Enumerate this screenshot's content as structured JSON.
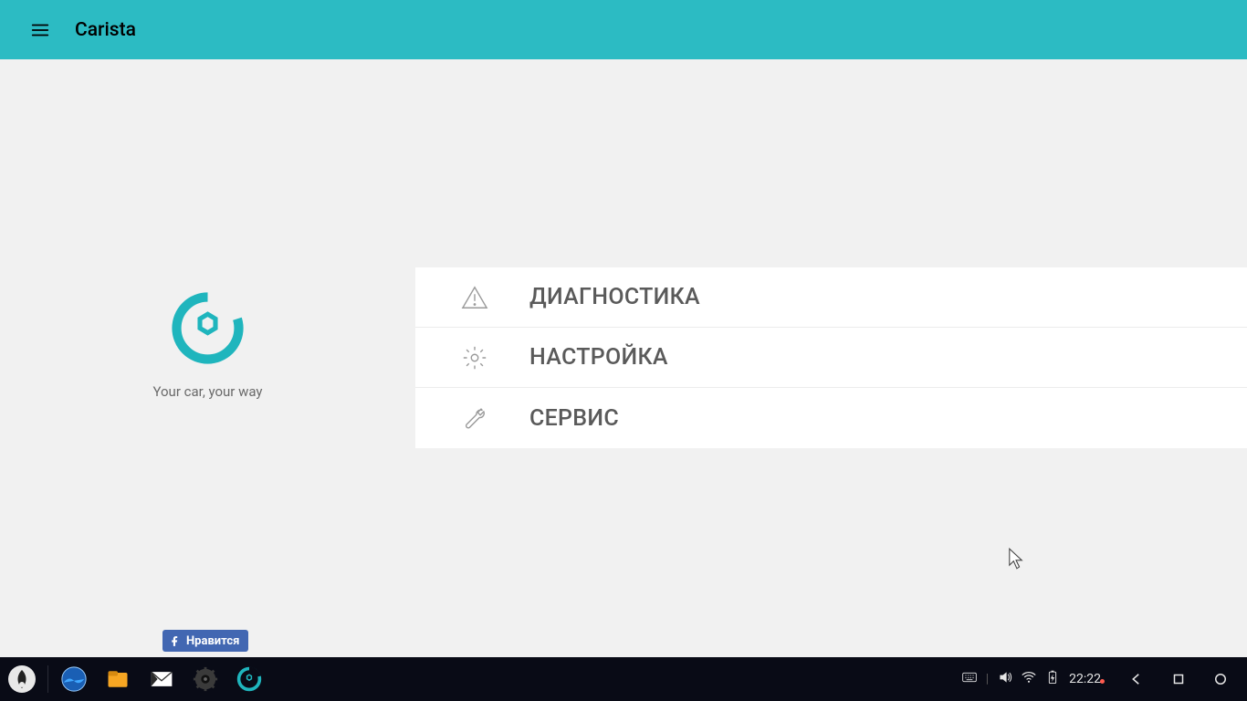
{
  "appbar": {
    "title": "Carista"
  },
  "brand": {
    "tagline": "Your car, your way",
    "accent_color": "#1fb5bd"
  },
  "social": {
    "fb_like_label": "Нравится"
  },
  "menu": {
    "items": [
      {
        "label": "ДИАГНОСТИКА",
        "icon": "warning-triangle-icon"
      },
      {
        "label": "НАСТРОЙКА",
        "icon": "gear-icon"
      },
      {
        "label": "СЕРВИС",
        "icon": "wrench-icon"
      }
    ]
  },
  "taskbar": {
    "clock": "22:22",
    "icons": [
      {
        "name": "phoenix-os-icon"
      },
      {
        "name": "browser-icon"
      },
      {
        "name": "files-icon"
      },
      {
        "name": "mail-icon"
      },
      {
        "name": "settings-icon"
      },
      {
        "name": "carista-app-icon"
      }
    ],
    "status": [
      {
        "name": "keyboard-icon"
      },
      {
        "name": "volume-icon"
      },
      {
        "name": "wifi-icon"
      },
      {
        "name": "battery-charging-icon"
      }
    ],
    "nav": [
      {
        "name": "back-button"
      },
      {
        "name": "home-button"
      },
      {
        "name": "recents-button"
      }
    ]
  }
}
